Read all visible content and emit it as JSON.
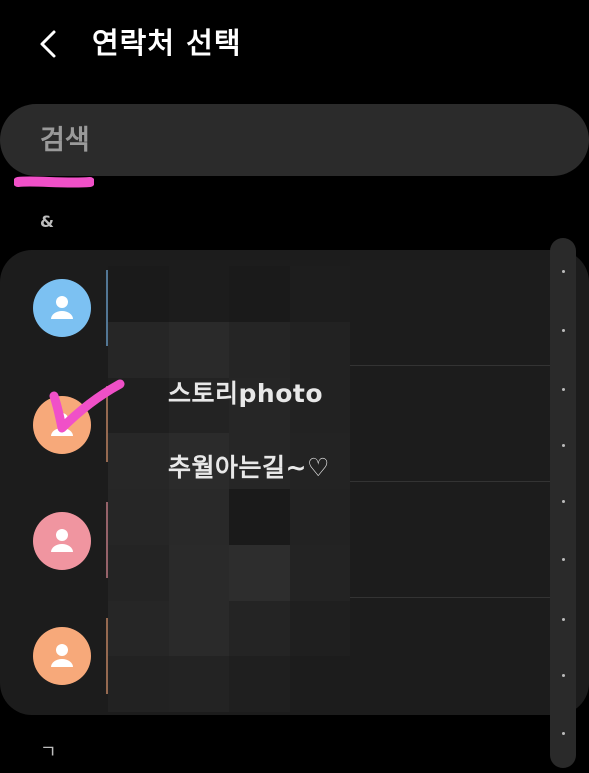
{
  "header": {
    "title": "연락처 선택",
    "back_icon": "chevron-left-icon"
  },
  "search": {
    "placeholder": "검색"
  },
  "sections": {
    "first": "&",
    "second": "ㄱ"
  },
  "contacts": [
    {
      "avatar_color": "#7cc1f2",
      "bar_color": "#6a9cc7"
    },
    {
      "avatar_color": "#f7a97a",
      "bar_color": "#c98a66"
    },
    {
      "avatar_color": "#f095a0",
      "bar_color": "#c9808a"
    },
    {
      "avatar_color": "#f7a97a",
      "bar_color": "#c98a66"
    }
  ],
  "overlay_text": {
    "line1": "스토리photo",
    "line2": "추월아는길~♡"
  },
  "colors": {
    "background": "#000000",
    "card": "#1c1c1c",
    "search": "#2b2b2b",
    "marker": "#f050c8"
  }
}
